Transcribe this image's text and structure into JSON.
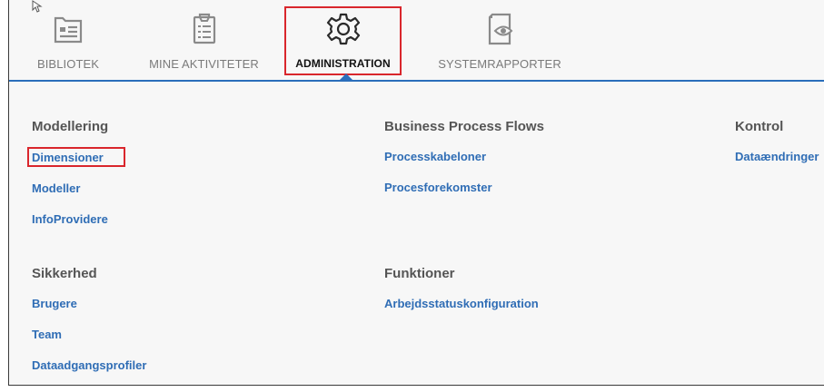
{
  "nav": {
    "items": [
      {
        "label": "BIBLIOTEK",
        "icon": "library-card-icon",
        "active": false
      },
      {
        "label": "MINE AKTIVITETER",
        "icon": "clipboard-list-icon",
        "active": false
      },
      {
        "label": "ADMINISTRATION",
        "icon": "gear-icon",
        "active": true
      },
      {
        "label": "SYSTEMRAPPORTER",
        "icon": "report-eye-icon",
        "active": false
      }
    ],
    "accent_color": "#2a6ebb",
    "highlight_color": "#d9262c"
  },
  "sections": {
    "modellering": {
      "title": "Modellering",
      "links": [
        "Dimensioner",
        "Modeller",
        "InfoProvidere"
      ]
    },
    "bpf": {
      "title": "Business Process Flows",
      "links": [
        "Processkabeloner",
        "Procesforekomster"
      ]
    },
    "kontrol": {
      "title": "Kontrol",
      "links": [
        "Dataændringer"
      ]
    },
    "sikkerhed": {
      "title": "Sikkerhed",
      "links": [
        "Brugere",
        "Team",
        "Dataadgangsprofiler"
      ]
    },
    "funktioner": {
      "title": "Funktioner",
      "links": [
        "Arbejdsstatuskonfiguration"
      ]
    }
  },
  "link_color": "#2f6db5"
}
